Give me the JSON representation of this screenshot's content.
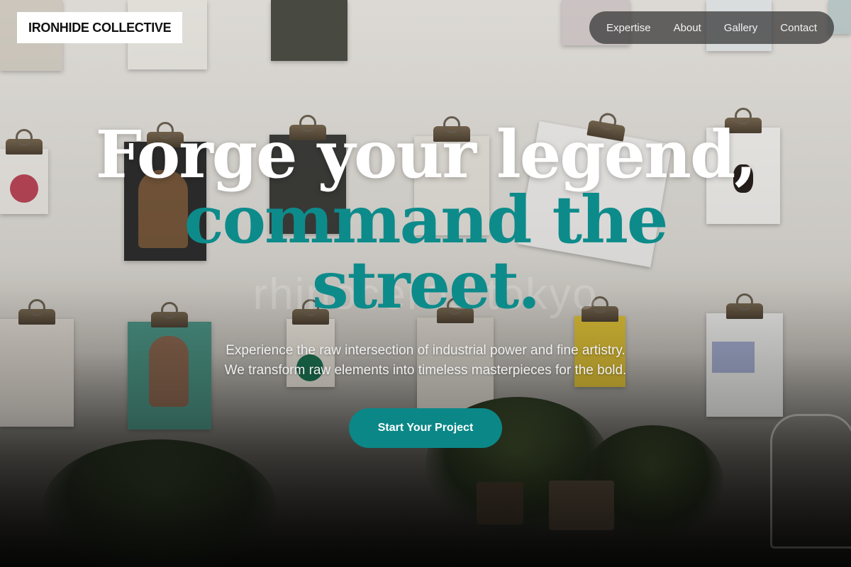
{
  "brand": {
    "name": "IRONHIDE COLLECTIVE"
  },
  "nav": {
    "items": [
      {
        "label": "Expertise"
      },
      {
        "label": "About"
      },
      {
        "label": "Gallery"
      },
      {
        "label": "Contact"
      }
    ]
  },
  "hero": {
    "headline_line1": "Forge your legend,",
    "headline_line2a": "command the",
    "headline_line2b": "street.",
    "background_text": "rhinoceros tokyo",
    "subtitle_line1": "Experience the raw intersection of industrial power and fine artistry.",
    "subtitle_line2": "We transform raw elements into timeless masterpieces for the bold.",
    "cta_label": "Start Your Project"
  },
  "colors": {
    "accent": "#0d8b8b",
    "button": "#0b8787",
    "nav_bg": "#323232",
    "logo_bg": "#ffffff"
  }
}
